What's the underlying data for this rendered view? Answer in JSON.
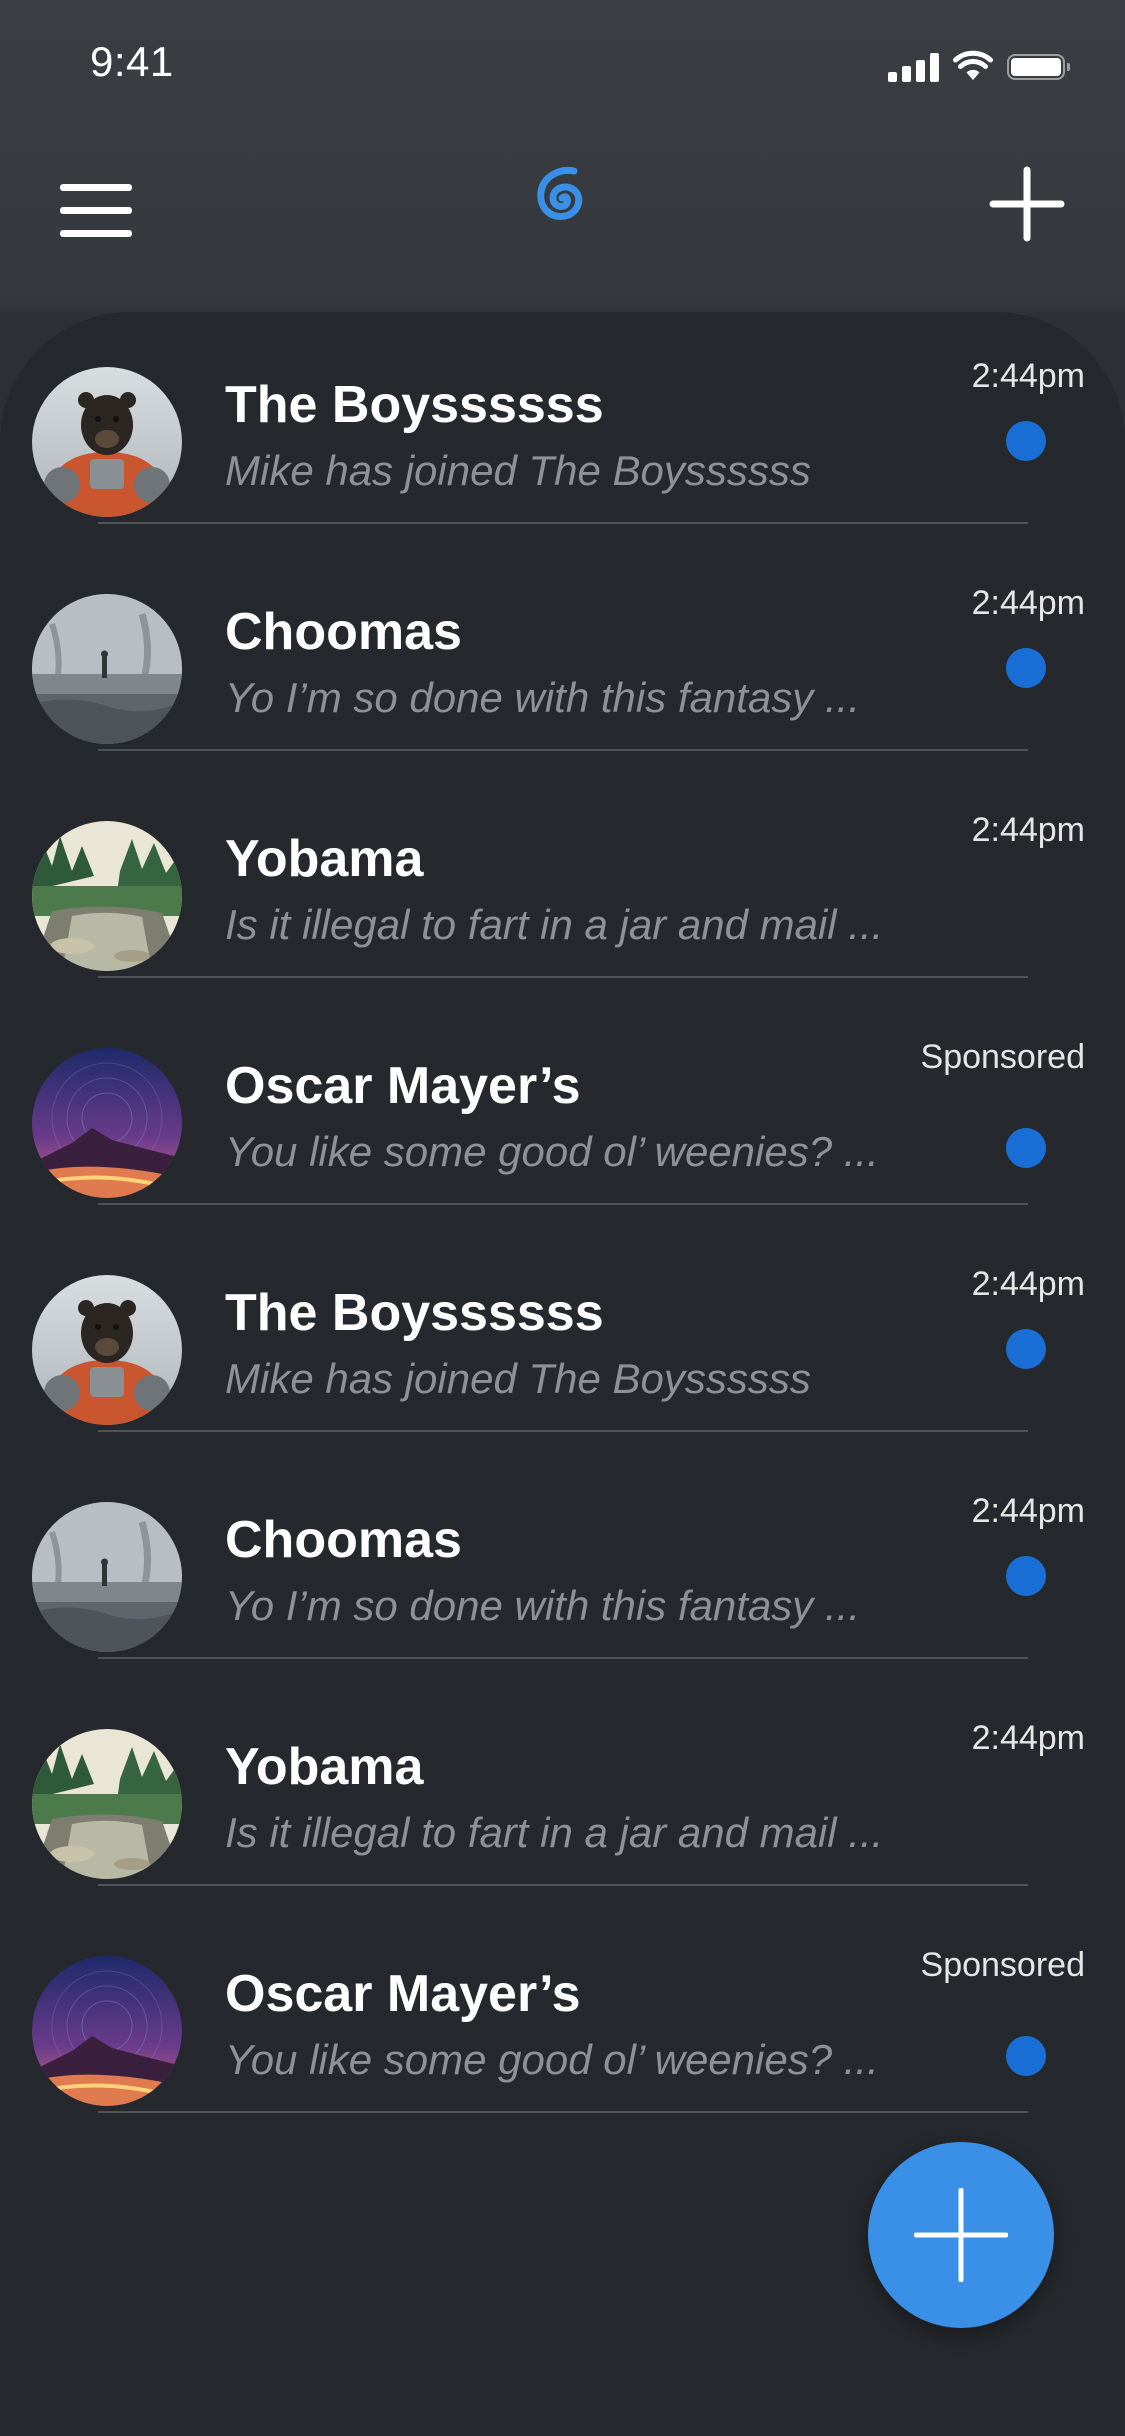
{
  "status_bar": {
    "time": "9:41"
  },
  "header": {
    "menu_icon": "hamburger-menu-icon",
    "logo_icon": "spiral-logo-icon",
    "add_icon": "plus-icon"
  },
  "conversations": [
    {
      "name": "The Boyssssss",
      "preview": "Mike has joined The Boyssssss",
      "time": "2:44pm",
      "unread": true,
      "avatar": "astronaut-bear"
    },
    {
      "name": "Choomas",
      "preview": "Yo I’m so done with this fantasy ...",
      "time": "2:44pm",
      "unread": true,
      "avatar": "misty-shore"
    },
    {
      "name": "Yobama",
      "preview": "Is it illegal to fart in a jar and mail ...",
      "time": "2:44pm",
      "unread": false,
      "avatar": "forest-river"
    },
    {
      "name": "Oscar Mayer’s",
      "preview": "You like some good ol’ weenies? ...",
      "time": "Sponsored",
      "unread": true,
      "avatar": "star-trail-mountain"
    },
    {
      "name": "The Boyssssss",
      "preview": "Mike has joined The Boyssssss",
      "time": "2:44pm",
      "unread": true,
      "avatar": "astronaut-bear"
    },
    {
      "name": "Choomas",
      "preview": "Yo I’m so done with this fantasy ...",
      "time": "2:44pm",
      "unread": true,
      "avatar": "misty-shore"
    },
    {
      "name": "Yobama",
      "preview": "Is it illegal to fart in a jar and mail ...",
      "time": "2:44pm",
      "unread": false,
      "avatar": "forest-river"
    },
    {
      "name": "Oscar Mayer’s",
      "preview": "You like some good ol’ weenies? ...",
      "time": "Sponsored",
      "unread": true,
      "avatar": "star-trail-mountain"
    }
  ],
  "fab": {
    "icon": "plus-icon"
  },
  "colors": {
    "accent": "#3a8fe6",
    "unread_dot": "#1a6fd6",
    "background": "#25282c",
    "header_background": "#3a3d42"
  }
}
